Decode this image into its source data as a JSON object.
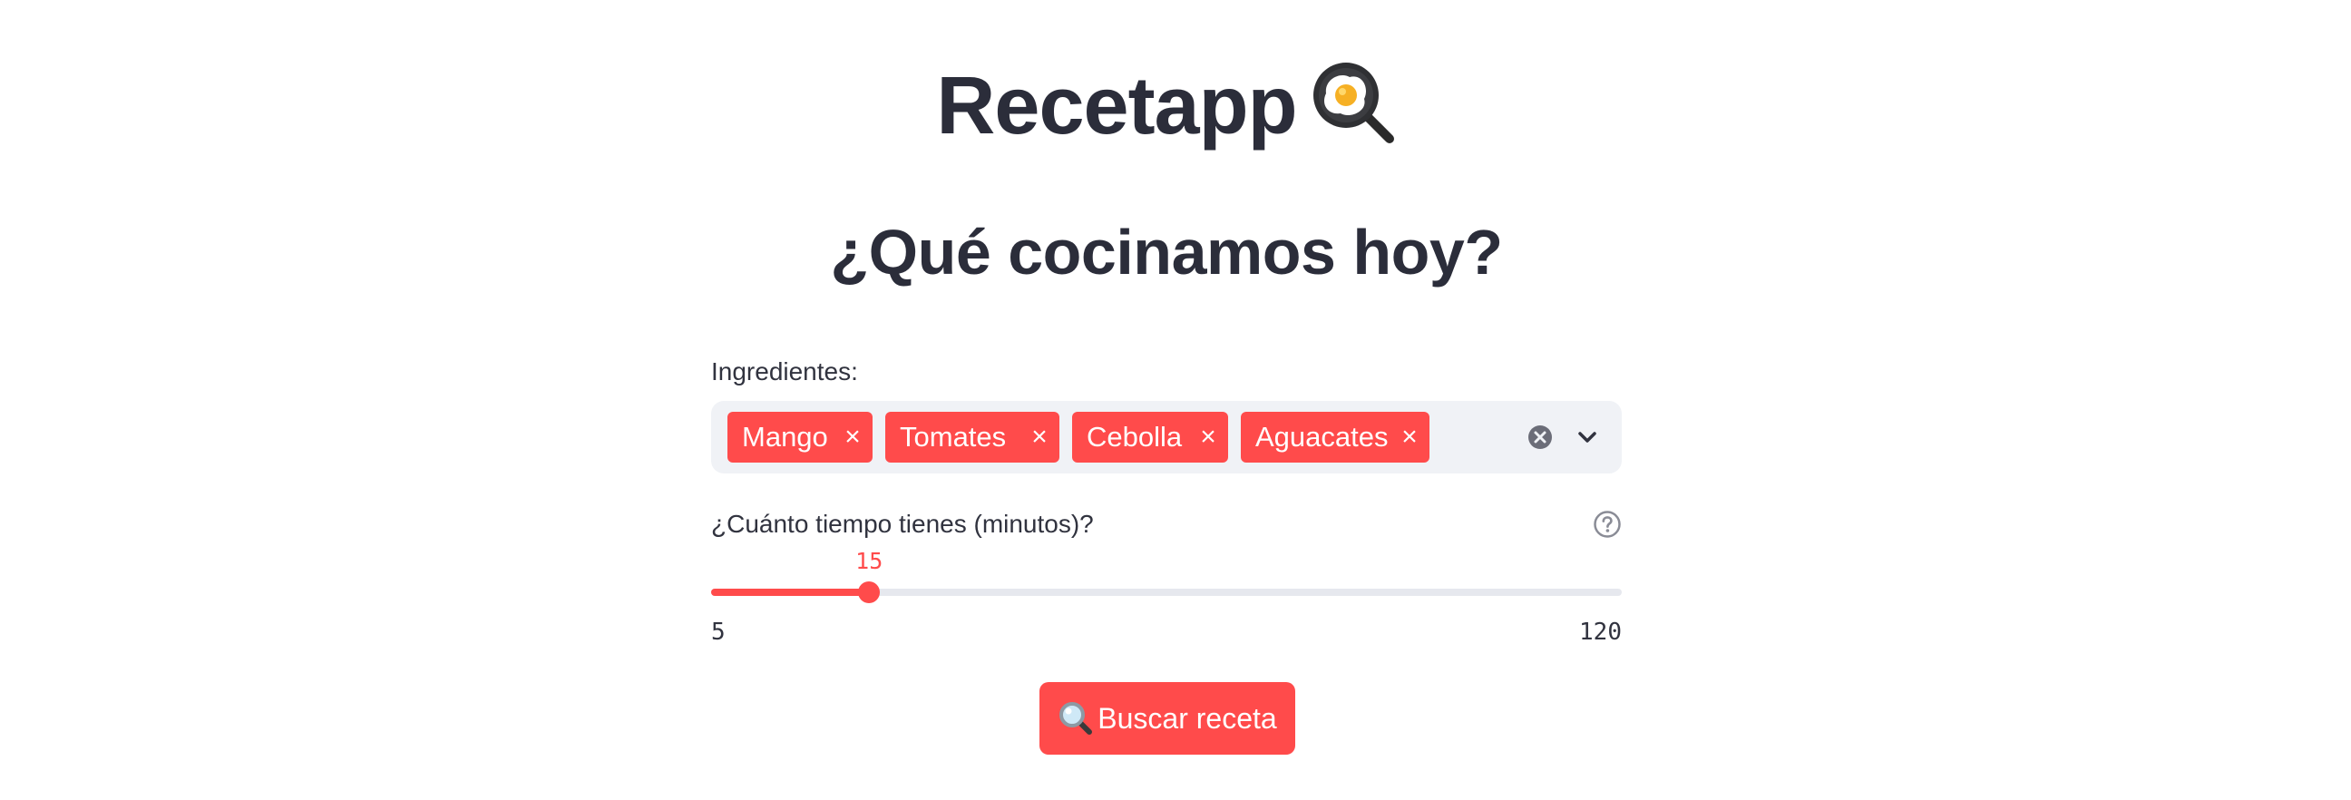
{
  "app": {
    "title": "Recetapp",
    "title_icon": "frying-pan-egg-icon",
    "subtitle": "¿Qué cocinamos hoy?"
  },
  "ingredients": {
    "label": "Ingredientes:",
    "selected": [
      "Mango",
      "Tomates",
      "Cebolla",
      "Aguacates"
    ],
    "remove_glyph": "×",
    "clear_icon": "clear-all-icon",
    "dropdown_icon": "chevron-down-icon"
  },
  "time": {
    "label": "¿Cuánto tiempo tienes (minutos)?",
    "help_icon": "help-circle-icon",
    "value": "15",
    "min": "5",
    "max": "120",
    "current": 15,
    "range": [
      5,
      120
    ]
  },
  "search": {
    "label": "Buscar receta",
    "icon": "magnifier-icon"
  },
  "colors": {
    "accent": "#ff4b4b",
    "text": "#31333f",
    "input_bg": "#f0f2f6"
  }
}
